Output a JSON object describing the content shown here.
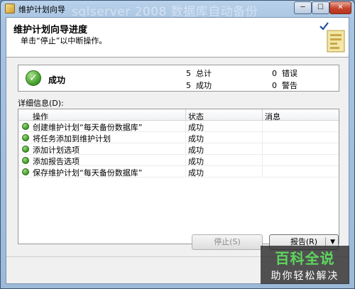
{
  "window": {
    "title": "维护计划向导",
    "ghost_text": "sqlserver 2008 数据库自动备份"
  },
  "titlebar_buttons": {
    "minimize": "─",
    "maximize": "☐",
    "close": "✕"
  },
  "header": {
    "title": "维护计划向导进度",
    "subtitle": "单击“停止”以中断操作。"
  },
  "summary": {
    "status": "成功",
    "total_count": "5",
    "total_label": "总计",
    "success_count": "5",
    "success_label": "成功",
    "error_count": "0",
    "error_label": "错误",
    "warning_count": "0",
    "warning_label": "警告"
  },
  "details": {
    "label": "详细信息(D):",
    "columns": [
      "操作",
      "状态",
      "消息"
    ],
    "rows": [
      {
        "action": "创建维护计划“每天备份数据库”",
        "status": "成功",
        "message": ""
      },
      {
        "action": "将任务添加到维护计划",
        "status": "成功",
        "message": ""
      },
      {
        "action": "添加计划选项",
        "status": "成功",
        "message": ""
      },
      {
        "action": "添加报告选项",
        "status": "成功",
        "message": ""
      },
      {
        "action": "保存维护计划“每天备份数据库”",
        "status": "成功",
        "message": ""
      }
    ]
  },
  "buttons": {
    "stop": "停止(S)",
    "report": "报告(R)"
  },
  "watermark": {
    "line1": "百科全说",
    "line2": "助你轻松解决"
  }
}
